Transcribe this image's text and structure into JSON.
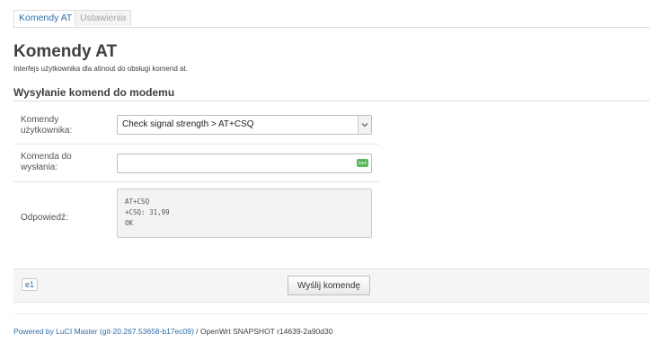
{
  "tabs": [
    {
      "label": "Komendy AT",
      "active": true
    },
    {
      "label": "Ustawienia",
      "active": false
    }
  ],
  "page": {
    "title": "Komendy AT",
    "description": "Interfejs użytkownika dla atinout do obsługi komend at."
  },
  "section": {
    "title": "Wysyłanie komend do modemu"
  },
  "form": {
    "user_commands_label_line1": "Komendy",
    "user_commands_label_line2": "użytkownika:",
    "user_commands_value": "Check signal strength > AT+CSQ",
    "command_label_line1": "Komenda do",
    "command_label_line2": "wysłania:",
    "command_value": "",
    "response_label": "Odpowiedź:",
    "response_value": "AT+CSQ\n+CSQ: 31,99\nOK"
  },
  "footer_bar": {
    "modem_label": "e1",
    "send_label": "Wyślij komendę"
  },
  "footer": {
    "link_text": "Powered by LuCI Master (git-20.267.53658-b17ec09)",
    "suffix": " / OpenWrt SNAPSHOT r14639-2a90d30"
  },
  "colors": {
    "link": "#2f6ea7",
    "addon_green": "#5cb85c"
  },
  "icons": {
    "select_arrow": "chevron-down-icon",
    "input_addon": "ellipsis-icon"
  }
}
